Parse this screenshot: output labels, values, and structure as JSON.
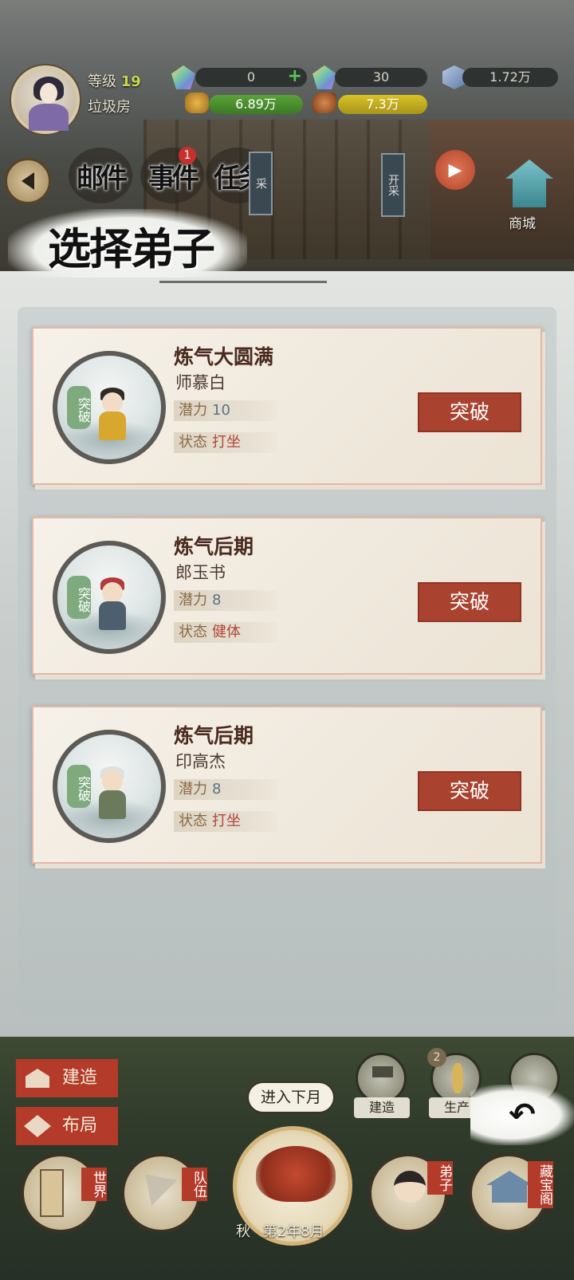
{
  "player": {
    "level_label": "等级",
    "level_value": "19",
    "location": "垃圾房"
  },
  "resources": {
    "jade": "0",
    "gem": "30",
    "crystal": "1.72万",
    "gold": "6.89万",
    "ore": "7.3万"
  },
  "top_menu": {
    "mail": "邮件",
    "events": "事件",
    "events_badge": "1",
    "tasks": "任务",
    "sign_left": "采",
    "sign_right": "开采",
    "shop": "商城"
  },
  "modal": {
    "title": "选择弟子",
    "potential_label": "潜力",
    "status_label": "状态",
    "tag_label": "突破",
    "disciples": [
      {
        "realm": "炼气大圆满",
        "name": "师慕白",
        "potential": "10",
        "status": "打坐",
        "action": "突破"
      },
      {
        "realm": "炼气后期",
        "name": "郎玉书",
        "potential": "8",
        "status": "健体",
        "action": "突破"
      },
      {
        "realm": "炼气后期",
        "name": "印高杰",
        "potential": "8",
        "status": "打坐",
        "action": "突破"
      }
    ]
  },
  "bottom": {
    "build": "建造",
    "layout": "布局",
    "build_tool": "建造",
    "produce_tool": "生产",
    "produce_badge": "2",
    "next_month": "进入下月",
    "season": "秋",
    "date": "第2年8月",
    "nav_world": "世界",
    "nav_team": "队伍",
    "nav_disciple": "弟子",
    "nav_treasure": "藏宝阁",
    "back": "↶"
  },
  "colors": {
    "accent_red": "#a9422f",
    "tag_green": "#7eaa7e",
    "card_bg": "#f6f1e9"
  }
}
